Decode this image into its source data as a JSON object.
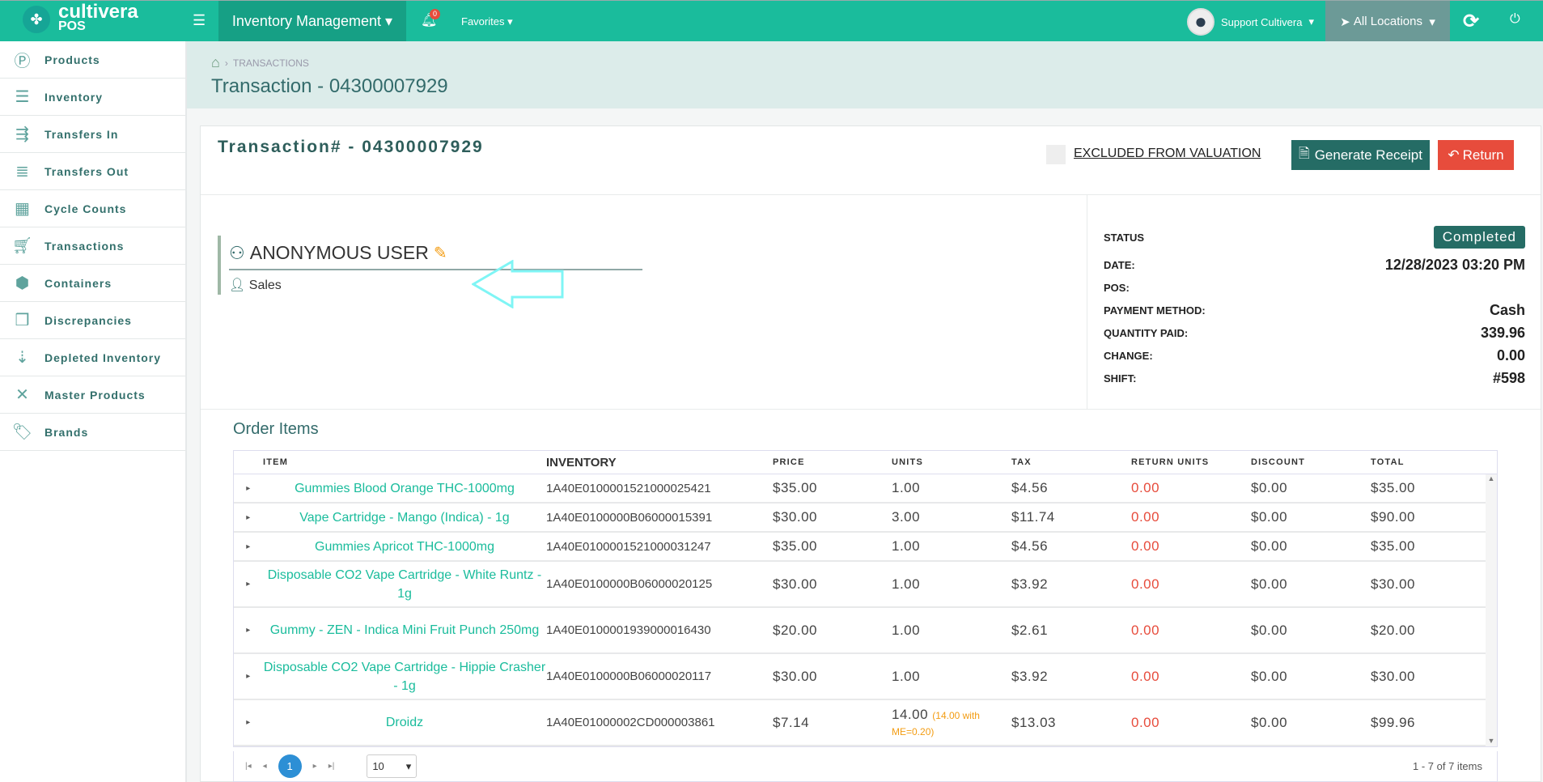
{
  "topbar": {
    "logo_top": "cultivera",
    "logo_bottom": "POS",
    "module": "Inventory Management",
    "notifications": "0",
    "favorites": "Favorites",
    "user": "Support Cultivera",
    "location": "All Locations"
  },
  "sidebar": {
    "items": [
      {
        "label": "Products",
        "icon": "p-circle-icon"
      },
      {
        "label": "Inventory",
        "icon": "server-icon"
      },
      {
        "label": "Transfers In",
        "icon": "transfer-in-icon"
      },
      {
        "label": "Transfers Out",
        "icon": "transfer-out-icon"
      },
      {
        "label": "Cycle Counts",
        "icon": "calculator-icon"
      },
      {
        "label": "Transactions",
        "icon": "cart-icon"
      },
      {
        "label": "Containers",
        "icon": "cube-icon"
      },
      {
        "label": "Discrepancies",
        "icon": "boxes-icon"
      },
      {
        "label": "Depleted Inventory",
        "icon": "sort-down-icon"
      },
      {
        "label": "Master Products",
        "icon": "pinwheel-icon"
      },
      {
        "label": "Brands",
        "icon": "tag-icon"
      }
    ]
  },
  "page": {
    "breadcrumb": "TRANSACTIONS",
    "title": "Transaction - 04300007929"
  },
  "card": {
    "title": "Transaction# - 04300007929",
    "excluded_label": "EXCLUDED FROM VALUATION",
    "generate_receipt": "Generate Receipt",
    "return": "Return"
  },
  "customer": {
    "name": "ANONYMOUS USER",
    "role": "Sales"
  },
  "details": {
    "status_label": "STATUS",
    "status": "Completed",
    "date_label": "DATE:",
    "date": "12/28/2023 03:20 PM",
    "pos_label": "POS:",
    "pos": "",
    "payment_label": "PAYMENT METHOD:",
    "payment": "Cash",
    "qty_paid_label": "QUANTITY PAID:",
    "qty_paid": "339.96",
    "change_label": "CHANGE:",
    "change": "0.00",
    "shift_label": "SHIFT:",
    "shift": "#598"
  },
  "order": {
    "title": "Order Items",
    "columns": [
      "ITEM",
      "INVENTORY",
      "PRICE",
      "UNITS",
      "TAX",
      "RETURN UNITS",
      "DISCOUNT",
      "TOTAL"
    ],
    "rows": [
      {
        "item": "Gummies Blood Orange THC-1000mg",
        "inventory": "1A40E0100001521000025421",
        "price": "$35.00",
        "units": "1.00",
        "units_note": "",
        "tax": "$4.56",
        "return_units": "0.00",
        "discount": "$0.00",
        "total": "$35.00"
      },
      {
        "item": "Vape Cartridge - Mango (Indica) - 1g",
        "inventory": "1A40E0100000B06000015391",
        "price": "$30.00",
        "units": "3.00",
        "units_note": "",
        "tax": "$11.74",
        "return_units": "0.00",
        "discount": "$0.00",
        "total": "$90.00"
      },
      {
        "item": "Gummies Apricot THC-1000mg",
        "inventory": "1A40E0100001521000031247",
        "price": "$35.00",
        "units": "1.00",
        "units_note": "",
        "tax": "$4.56",
        "return_units": "0.00",
        "discount": "$0.00",
        "total": "$35.00"
      },
      {
        "item": "Disposable CO2 Vape Cartridge - White Runtz - 1g",
        "inventory": "1A40E0100000B06000020125",
        "price": "$30.00",
        "units": "1.00",
        "units_note": "",
        "tax": "$3.92",
        "return_units": "0.00",
        "discount": "$0.00",
        "total": "$30.00"
      },
      {
        "item": "Gummy - ZEN - Indica Mini Fruit Punch 250mg",
        "inventory": "1A40E0100001939000016430",
        "price": "$20.00",
        "units": "1.00",
        "units_note": "",
        "tax": "$2.61",
        "return_units": "0.00",
        "discount": "$0.00",
        "total": "$20.00"
      },
      {
        "item": "Disposable CO2 Vape Cartridge - Hippie Crasher - 1g",
        "inventory": "1A40E0100000B06000020117",
        "price": "$30.00",
        "units": "1.00",
        "units_note": "",
        "tax": "$3.92",
        "return_units": "0.00",
        "discount": "$0.00",
        "total": "$30.00"
      },
      {
        "item": "Droidz",
        "inventory": "1A40E01000002CD000003861",
        "price": "$7.14",
        "units": "14.00",
        "units_note": "(14.00 with ME=0.20)",
        "tax": "$13.03",
        "return_units": "0.00",
        "discount": "$0.00",
        "total": "$99.96"
      }
    ]
  },
  "pager": {
    "current": "1",
    "page_size": "10",
    "info": "1 - 7 of 7 items"
  },
  "colors": {
    "brand": "#1abc9c",
    "dark_teal": "#256c65",
    "danger": "#e74c3c",
    "warning": "#f39c12"
  }
}
